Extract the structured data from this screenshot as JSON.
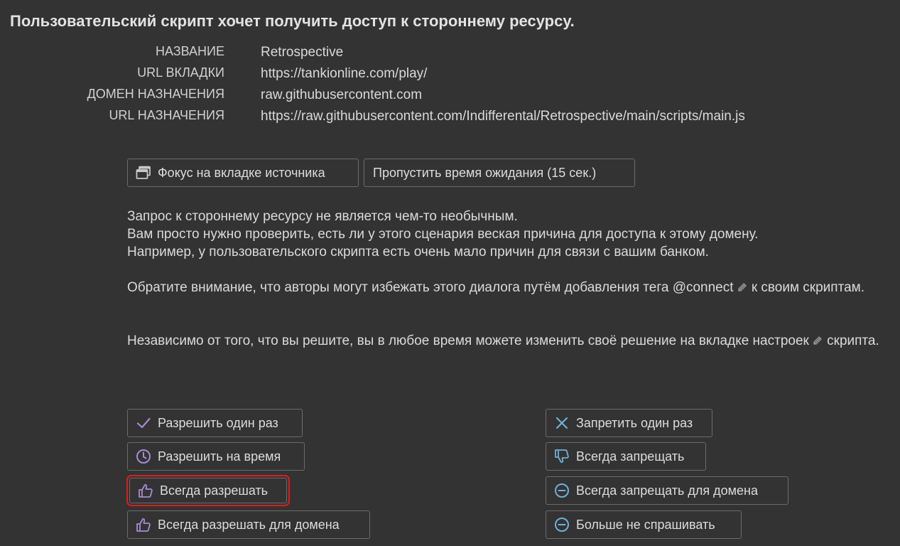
{
  "title": "Пользовательский скрипт хочет получить доступ к стороннему ресурсу.",
  "info": [
    {
      "key": "НАЗВАНИЕ",
      "value": "Retrospective"
    },
    {
      "key": "URL ВКЛАДКИ",
      "value": "https://tankionline.com/play/"
    },
    {
      "key": "ДОМЕН НАЗНАЧЕНИЯ",
      "value": "raw.githubusercontent.com"
    },
    {
      "key": "URL НАЗНАЧЕНИЯ",
      "value": "https://raw.githubusercontent.com/Indifferental/Retrospective/main/scripts/main.js"
    }
  ],
  "top_buttons": {
    "focus_tab": "Фокус на вкладке источника",
    "skip_timeout": "Пропустить время ожидания (15 сек.)"
  },
  "description": {
    "p1_l1": "Запрос к стороннему ресурсу не является чем-то необычным.",
    "p1_l2": "Вам просто нужно проверить, есть ли у этого сценария веская причина для доступа к этому домену.",
    "p1_l3": "Например, у пользовательского скрипта есть очень мало причин для связи с вашим банком.",
    "p2_before": "Обратите внимание, что авторы могут избежать этого диалога путём добавления тега",
    "p2_link": "@connect",
    "p2_after": "к своим скриптам.",
    "p3_before": "Независимо от того, что вы решите, вы в любое время можете изменить своё решение на",
    "p3_link": "вкладке настроек",
    "p3_after": "скрипта."
  },
  "allow_buttons": [
    {
      "label": "Разрешить один раз",
      "icon": "check-icon"
    },
    {
      "label": "Разрешить на время",
      "icon": "clock-icon"
    },
    {
      "label": "Всегда разрешать",
      "icon": "thumbs-up-icon"
    },
    {
      "label": "Всегда разрешать для домена",
      "icon": "thumbs-up-icon"
    }
  ],
  "deny_buttons": [
    {
      "label": "Запретить один раз",
      "icon": "x-icon"
    },
    {
      "label": "Всегда запрещать",
      "icon": "thumbs-down-icon"
    },
    {
      "label": "Всегда запрещать для домена",
      "icon": "minus-circle-icon"
    },
    {
      "label": "Больше не спрашивать",
      "icon": "minus-circle-icon"
    }
  ],
  "colors": {
    "background": "#333333",
    "allow_icon": "#a88bd6",
    "deny_icon": "#6fb1d8",
    "highlight": "#e01b1b"
  }
}
